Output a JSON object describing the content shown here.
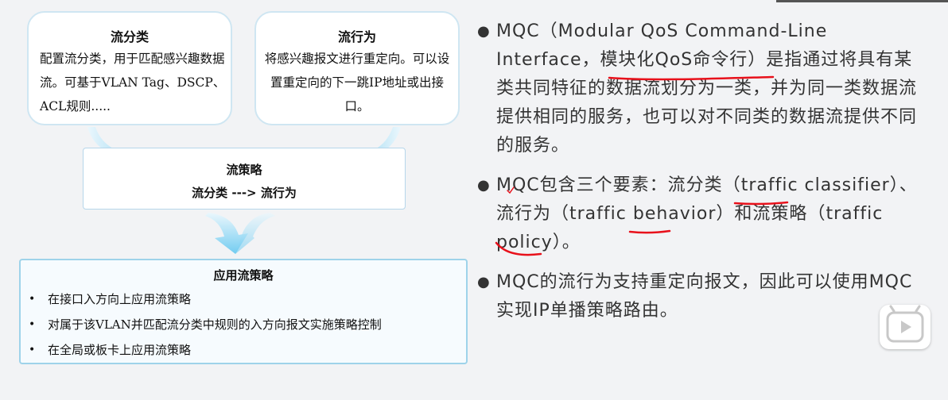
{
  "classifier": {
    "title": "流分类",
    "text": "配置流分类，用于匹配感兴趣数据流。可基于VLAN Tag、DSCP、ACL规则....."
  },
  "behavior": {
    "title": "流行为",
    "text": "将感兴趣报文进行重定向。可以设置重定向的下一跳IP地址或出接口。"
  },
  "policy": {
    "title": "流策略",
    "subtitle": "流分类 ---> 流行为"
  },
  "apply": {
    "title": "应用流策略",
    "items": [
      "在接口入方向上应用流策略",
      "对属于该VLAN并匹配流分类中规则的入方向报文实施策略控制",
      "在全局或板卡上应用流策略"
    ]
  },
  "bullets": {
    "symbol": "●",
    "p1_a": "MQC（Modular QoS Command-Line Interface，",
    "p1_hl": "模块化QoS命令行",
    "p1_b": "）是指通过将具有某类共同特征的数据流划分为一类，并为同一类数据流提供相同的服务，也可以对不同类的数据流提供不同的服务。",
    "p2_a": "MQC包含三个要素：",
    "p2_hl1": "流分类",
    "p2_b": "（traffic classifier）、",
    "p2_hl2": "流行为",
    "p2_c": "（traffic behavior）和流",
    "p2_hl3": "策略",
    "p2_d": "（traffic policy）。",
    "p3": "MQC的流行为支持重定向报文，因此可以使用MQC实现IP单播策略路由。"
  },
  "colors": {
    "box_border": "#cfe6f2",
    "arrow": "#5bc0eb",
    "annotation": "#e8111b",
    "background": "#f2f3f5"
  },
  "icons": {
    "play": "play-icon",
    "arrow": "curved-arrow-icon"
  }
}
